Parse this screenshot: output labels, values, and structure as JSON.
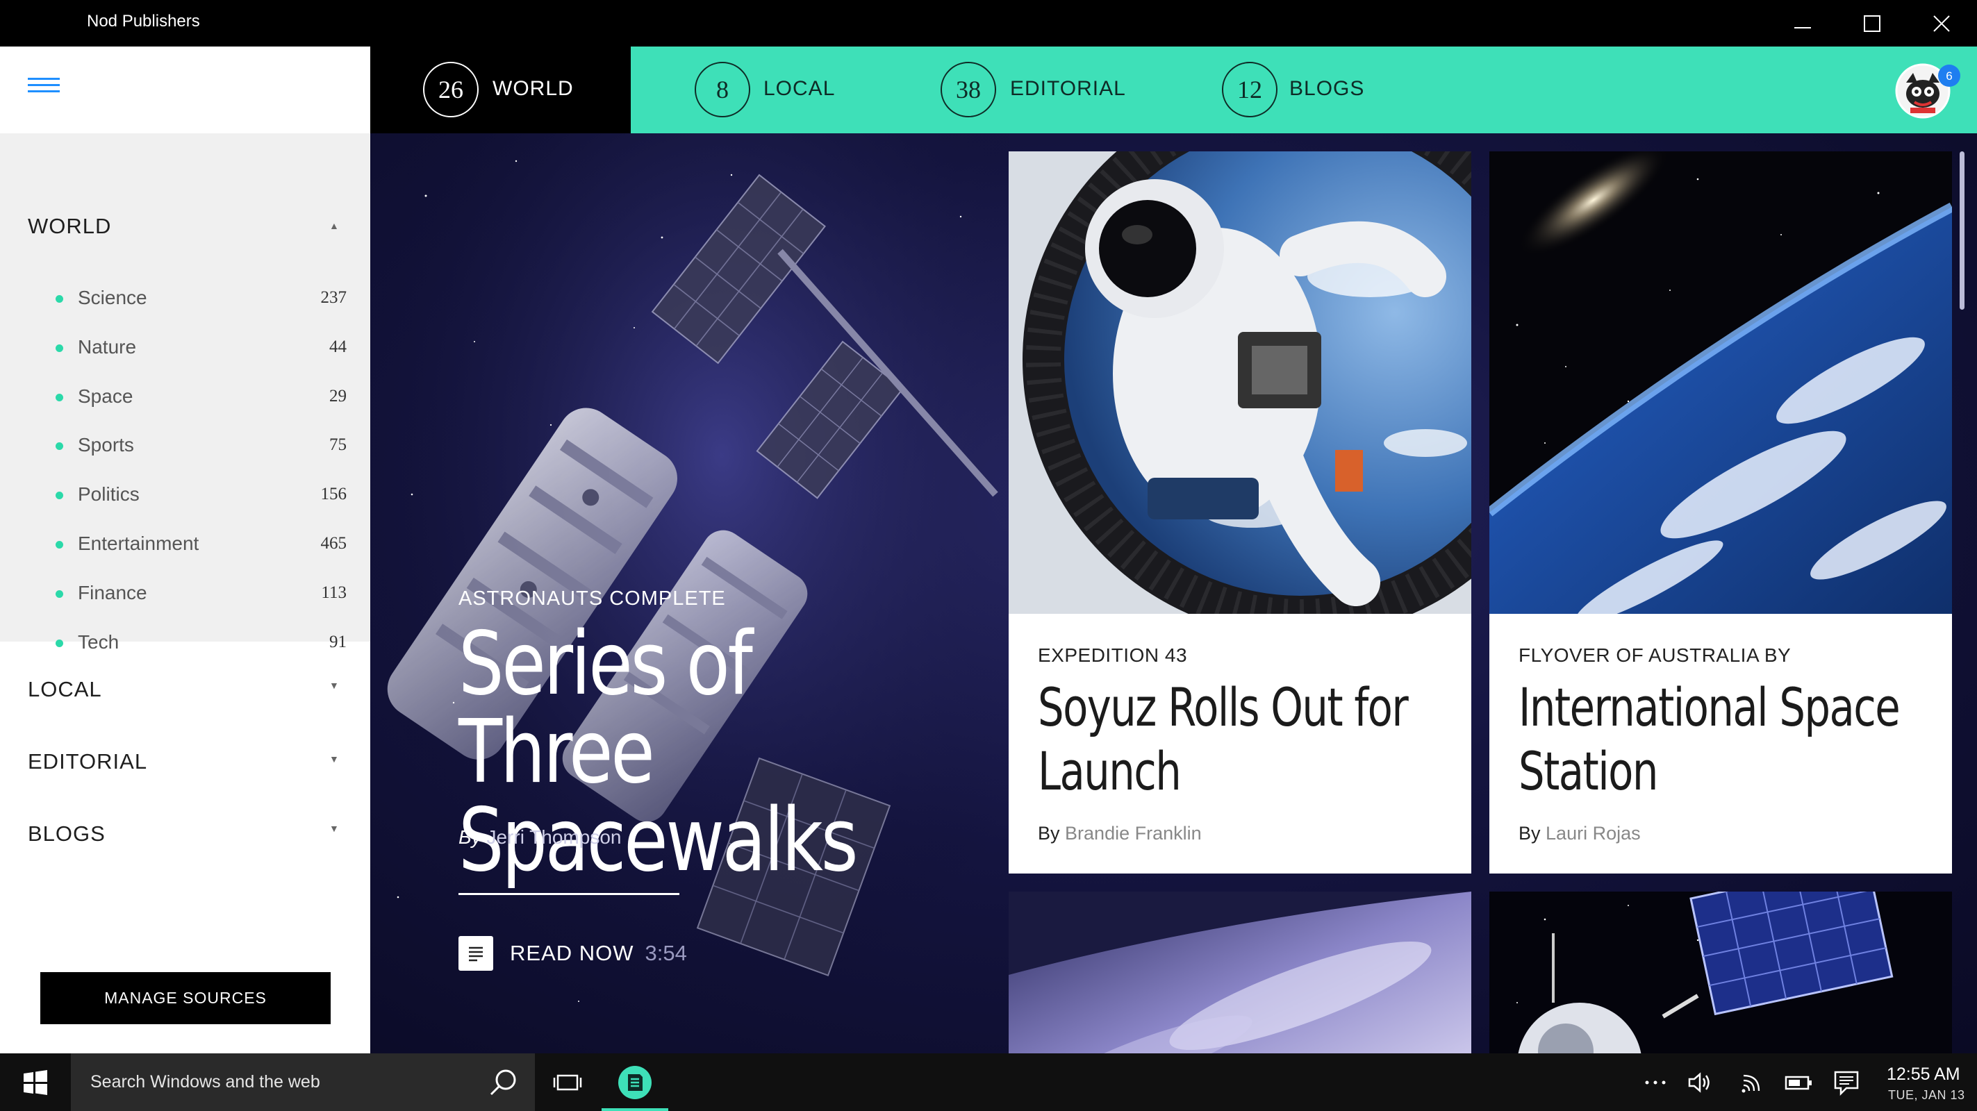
{
  "window": {
    "title": "Nod Publishers"
  },
  "nav": {
    "tabs": [
      {
        "count": "26",
        "label": "WORLD",
        "active": true
      },
      {
        "count": "8",
        "label": "LOCAL"
      },
      {
        "count": "38",
        "label": "EDITORIAL"
      },
      {
        "count": "12",
        "label": "BLOGS"
      }
    ],
    "notification_count": "6"
  },
  "sidebar": {
    "sections": [
      {
        "label": "WORLD",
        "expanded": true
      },
      {
        "label": "LOCAL",
        "expanded": false
      },
      {
        "label": "EDITORIAL",
        "expanded": false
      },
      {
        "label": "BLOGS",
        "expanded": false
      }
    ],
    "world_items": [
      {
        "label": "Science",
        "count": "237"
      },
      {
        "label": "Nature",
        "count": "44"
      },
      {
        "label": "Space",
        "count": "29"
      },
      {
        "label": "Sports",
        "count": "75"
      },
      {
        "label": "Politics",
        "count": "156"
      },
      {
        "label": "Entertainment",
        "count": "465"
      },
      {
        "label": "Finance",
        "count": "113"
      },
      {
        "label": "Tech",
        "count": "91"
      }
    ],
    "manage_label": "MANAGE SOURCES",
    "accent": "#2bd9a9"
  },
  "hero": {
    "kicker": "ASTRONAUTS COMPLETE",
    "title": "Series of Three Spacewalks",
    "by": "By",
    "author": "Jerri Thompson",
    "read_label": "READ NOW",
    "read_time": "3:54"
  },
  "cards": [
    {
      "kicker": "EXPEDITION 43",
      "title": "Soyuz Rolls Out for Launch",
      "by": "By",
      "author": "Brandie Franklin"
    },
    {
      "kicker": "FLYOVER OF AUSTRALIA BY",
      "title": "International Space Station",
      "by": "By",
      "author": "Lauri Rojas"
    }
  ],
  "taskbar": {
    "search_placeholder": "Search Windows and the web",
    "time": "12:55 AM",
    "date": "TUE, JAN 13"
  },
  "colors": {
    "nav_bg": "#3ee0b8",
    "content_bg": "#14143f"
  },
  "icons": [
    "hamburger-icon",
    "minimize-icon",
    "maximize-icon",
    "close-icon",
    "windows-start-icon",
    "search-icon",
    "task-view-icon",
    "nod-app-icon",
    "more-icon",
    "volume-icon",
    "wifi-icon",
    "battery-icon",
    "action-center-icon",
    "article-icon"
  ]
}
